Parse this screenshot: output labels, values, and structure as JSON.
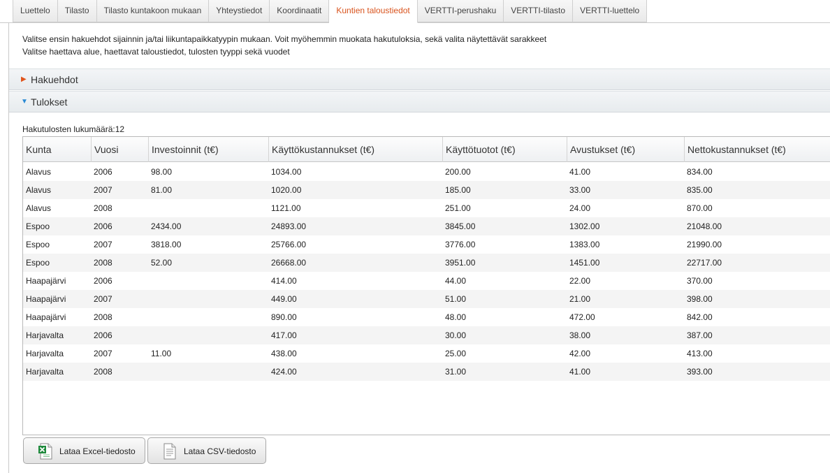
{
  "tabs": [
    {
      "label": "Luettelo"
    },
    {
      "label": "Tilasto"
    },
    {
      "label": "Tilasto kuntakoon mukaan"
    },
    {
      "label": "Yhteystiedot"
    },
    {
      "label": "Koordinaatit"
    },
    {
      "label": "Kuntien taloustiedot",
      "active": true
    },
    {
      "label": "VERTTI-perushaku"
    },
    {
      "label": "VERTTI-tilasto"
    },
    {
      "label": "VERTTI-luettelo"
    }
  ],
  "intro": {
    "line1": "Valitse ensin hakuehdot sijainnin ja/tai liikuntapaikkatyypin mukaan. Voit myöhemmin muokata hakutuloksia, sekä valita näytettävät sarakkeet",
    "line2": "Valitse haettava alue, haettavat taloustiedot, tulosten tyyppi sekä vuodet"
  },
  "sections": {
    "hakuehdot": {
      "label": "Hakuehdot",
      "expanded": false
    },
    "tulokset": {
      "label": "Tulokset",
      "expanded": true
    }
  },
  "results": {
    "count_label": "Hakutulosten lukumäärä:12",
    "columns": [
      "Kunta",
      "Vuosi",
      "Investoinnit (t€)",
      "Käyttökustannukset (t€)",
      "Käyttötuotot (t€)",
      "Avustukset (t€)",
      "Nettokustannukset (t€)"
    ],
    "rows": [
      [
        "Alavus",
        "2006",
        "98.00",
        "1034.00",
        "200.00",
        "41.00",
        "834.00"
      ],
      [
        "Alavus",
        "2007",
        "81.00",
        "1020.00",
        "185.00",
        "33.00",
        "835.00"
      ],
      [
        "Alavus",
        "2008",
        "",
        "1121.00",
        "251.00",
        "24.00",
        "870.00"
      ],
      [
        "Espoo",
        "2006",
        "2434.00",
        "24893.00",
        "3845.00",
        "1302.00",
        "21048.00"
      ],
      [
        "Espoo",
        "2007",
        "3818.00",
        "25766.00",
        "3776.00",
        "1383.00",
        "21990.00"
      ],
      [
        "Espoo",
        "2008",
        "52.00",
        "26668.00",
        "3951.00",
        "1451.00",
        "22717.00"
      ],
      [
        "Haapajärvi",
        "2006",
        "",
        "414.00",
        "44.00",
        "22.00",
        "370.00"
      ],
      [
        "Haapajärvi",
        "2007",
        "",
        "449.00",
        "51.00",
        "21.00",
        "398.00"
      ],
      [
        "Haapajärvi",
        "2008",
        "",
        "890.00",
        "48.00",
        "472.00",
        "842.00"
      ],
      [
        "Harjavalta",
        "2006",
        "",
        "417.00",
        "30.00",
        "38.00",
        "387.00"
      ],
      [
        "Harjavalta",
        "2007",
        "11.00",
        "438.00",
        "25.00",
        "42.00",
        "413.00"
      ],
      [
        "Harjavalta",
        "2008",
        "",
        "424.00",
        "31.00",
        "41.00",
        "393.00"
      ]
    ]
  },
  "buttons": {
    "excel_label": "Lataa Excel-tiedosto",
    "csv_label": "Lataa CSV-tiedosto"
  },
  "colors": {
    "active_tab": "#d9541e",
    "collapsed_arrow": "#e0541b",
    "expanded_arrow": "#2a8ad4"
  },
  "icons": {
    "collapsed": "triangle-right-icon",
    "expanded": "triangle-down-icon",
    "excel": "excel-file-icon",
    "csv": "csv-file-icon"
  }
}
